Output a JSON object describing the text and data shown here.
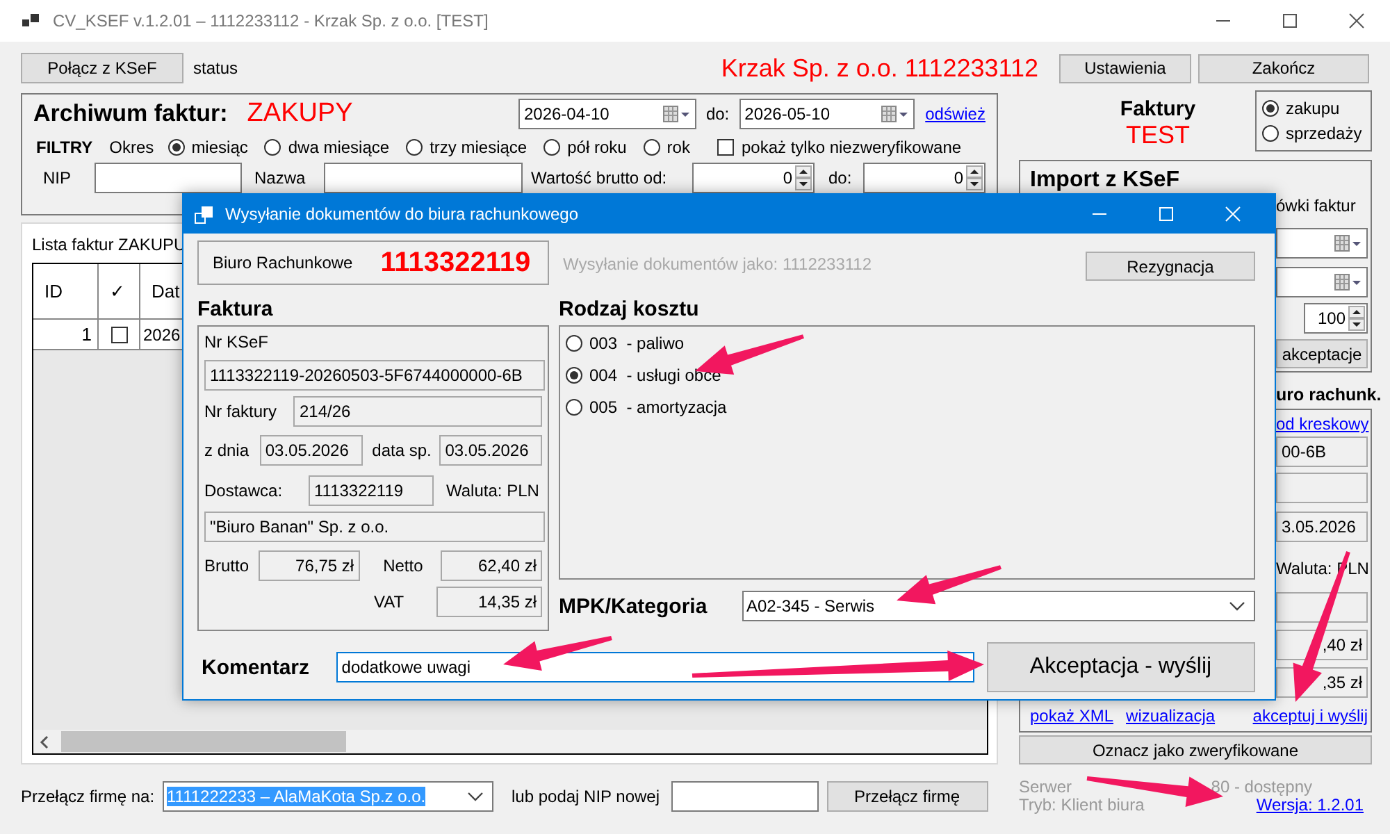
{
  "window": {
    "title": "CV_KSEF v.1.2.01 – 1112233112 - Krzak Sp. z o.o. [TEST]"
  },
  "toolbar": {
    "connect_button": "Połącz z KSeF",
    "status": "status",
    "company": "Krzak Sp. z o.o. 1112233112",
    "buttons": [
      "Ustawienia",
      "Zakończ"
    ]
  },
  "archive": {
    "title": "Archiwum faktur:",
    "type": "ZAKUPY",
    "date_from": "2026-04-10",
    "to_label": "do:",
    "date_to": "2026-05-10",
    "refresh_link": "odśwież",
    "filters_label": "FILTRY",
    "period_label": "Okres",
    "periods": [
      {
        "label": "miesiąc",
        "selected": true
      },
      {
        "label": "dwa miesiące",
        "selected": false
      },
      {
        "label": "trzy miesiące",
        "selected": false
      },
      {
        "label": "pół roku",
        "selected": false
      },
      {
        "label": "rok",
        "selected": false
      }
    ],
    "unverified_only": {
      "label": "pokaż tylko niezweryfikowane",
      "checked": false
    },
    "nip_label": "NIP",
    "name_label": "Nazwa",
    "gross_from_label": "Wartość brutto od:",
    "gross_from": "0",
    "gross_to_label": "do:",
    "gross_to": "0"
  },
  "list": {
    "tab": "Lista faktur ZAKUPU",
    "columns": [
      "ID",
      "✓",
      "Dat"
    ],
    "rows": [
      {
        "id": "1",
        "checked": false,
        "date": "2026"
      }
    ]
  },
  "switch_company": {
    "label": "Przełącz firmę na:",
    "value": "1111222233 – AlaMaKota Sp.z o.o.",
    "nip_label": "lub podaj NIP nowej",
    "button": "Przełącz firmę"
  },
  "invoices_kind": {
    "title": "Faktury",
    "env": "TEST",
    "options": [
      {
        "label": "zakupu",
        "selected": true
      },
      {
        "label": "sprzedaży",
        "selected": false
      }
    ]
  },
  "import_panel": {
    "title": "Import z KSeF",
    "fragment": "ówki faktur",
    "spin": "100",
    "button": "akceptacje"
  },
  "office_panel": {
    "heading": "uro rachunk.",
    "link": "od kreskowy",
    "ksef": "00-6B",
    "date": "3.05.2026",
    "currency": "Waluta: PLN",
    "net": ",40 zł",
    "vat": ",35 zł",
    "links": [
      "pokaż XML",
      "wizualizacja",
      "akceptuj i wyślij"
    ],
    "verify_button": "Oznacz jako zweryfikowane"
  },
  "status_bar": {
    "server_start": "Serwer",
    "server_end": "80 - dostępny",
    "mode": "Tryb: Klient biura",
    "version_link": "Wersja: 1.2.01"
  },
  "dialog": {
    "title": "Wysyłanie dokumentów do biura rachunkowego",
    "office_label": "Biuro Rachunkowe",
    "office_nip": "1113322119",
    "sending_as": "Wysyłanie dokumentów jako: 1112233112",
    "cancel_button": "Rezygnacja",
    "invoice": {
      "title": "Faktura",
      "ksef_label": "Nr KSeF",
      "ksef": "1113322119-20260503-5F6744000000-6B",
      "number_label": "Nr faktury",
      "number": "214/26",
      "date_label": "z dnia",
      "date": "03.05.2026",
      "sale_date_label": "data sp.",
      "sale_date": "03.05.2026",
      "supplier_label": "Dostawca:",
      "supplier_nip": "1113322119",
      "currency": "Waluta: PLN",
      "supplier_name": "\"Biuro Banan\" Sp. z o.o.",
      "gross_label": "Brutto",
      "gross": "76,75 zł",
      "net_label": "Netto",
      "net": "62,40 zł",
      "vat_label": "VAT",
      "vat": "14,35 zł"
    },
    "cost_type": {
      "title": "Rodzaj kosztu",
      "options": [
        {
          "code": "003",
          "label": "- paliwo",
          "selected": false
        },
        {
          "code": "004",
          "label": "- usługi obce",
          "selected": true
        },
        {
          "code": "005",
          "label": "- amortyzacja",
          "selected": false
        }
      ]
    },
    "category": {
      "label": "MPK/Kategoria",
      "value": "A02-345 - Serwis"
    },
    "comment": {
      "label": "Komentarz",
      "value": "dodatkowe uwagi"
    },
    "submit_button": "Akceptacja - wyślij"
  }
}
